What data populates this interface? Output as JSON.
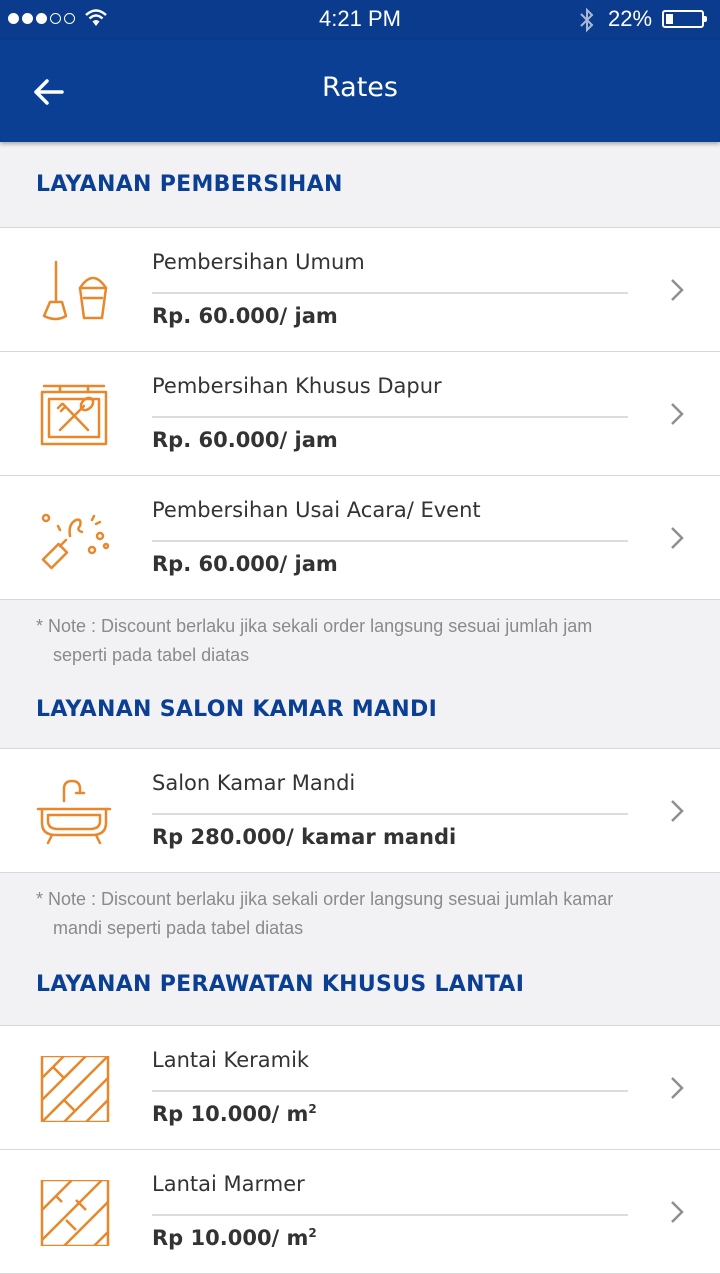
{
  "status_bar": {
    "time": "4:21 PM",
    "battery_percent": "22%",
    "battery_level": 0.22,
    "signal_bars": 3
  },
  "nav": {
    "title": "Rates"
  },
  "sections": [
    {
      "title": "LAYANAN PEMBERSIHAN",
      "items": [
        {
          "name": "Pembersihan Umum",
          "price": "Rp. 60.000/ jam",
          "icon": "broom-bucket-icon"
        },
        {
          "name": "Pembersihan Khusus Dapur",
          "price": "Rp. 60.000/ jam",
          "icon": "kitchen-sign-icon"
        },
        {
          "name": "Pembersihan Usai Acara/ Event",
          "price": "Rp. 60.000/ jam",
          "icon": "party-popper-icon"
        }
      ],
      "note_line1": "* Note : Discount berlaku jika sekali order langsung sesuai jumlah jam",
      "note_line2": "seperti pada tabel diatas"
    },
    {
      "title": "LAYANAN SALON KAMAR MANDI",
      "items": [
        {
          "name": "Salon Kamar Mandi",
          "price": "Rp 280.000/ kamar mandi",
          "icon": "bathtub-icon"
        }
      ],
      "note_line1": "* Note : Discount berlaku jika sekali order langsung sesuai jumlah kamar",
      "note_line2": "mandi seperti pada tabel diatas"
    },
    {
      "title": "LAYANAN PERAWATAN KHUSUS LANTAI",
      "items": [
        {
          "name": "Lantai Keramik",
          "price": "Rp 10.000/ m",
          "price_sup": "2",
          "icon": "ceramic-tile-icon"
        },
        {
          "name": "Lantai Marmer",
          "price": "Rp 10.000/ m",
          "price_sup": "2",
          "icon": "marble-tile-icon"
        }
      ]
    }
  ],
  "colors": {
    "primary": "#0a3f94",
    "accent": "#e8872c",
    "background": "#f2f2f4"
  }
}
